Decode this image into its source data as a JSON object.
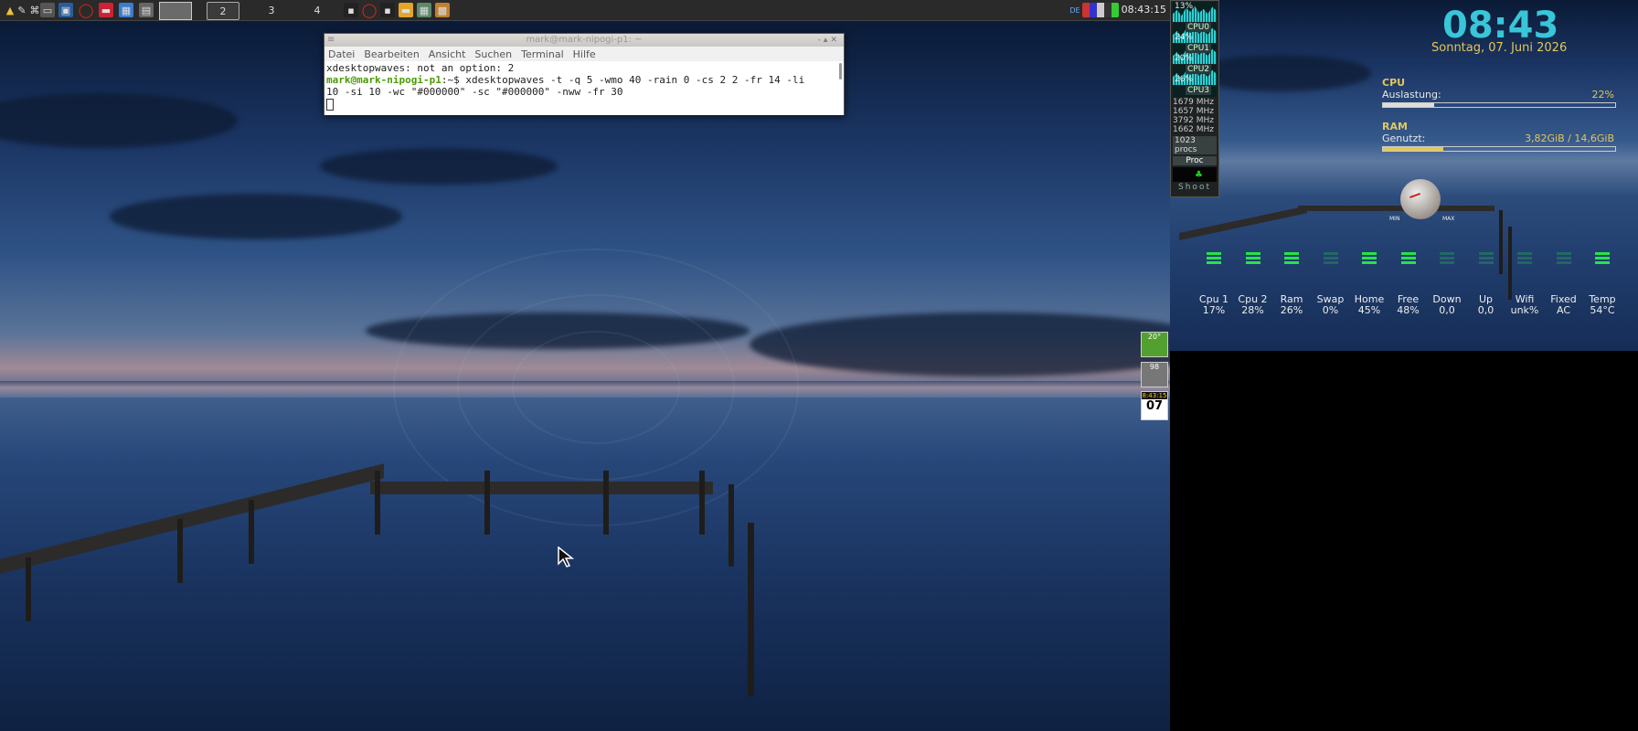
{
  "taskbar": {
    "workspaces": [
      {
        "label": ""
      },
      {
        "label": "2"
      },
      {
        "label": "3"
      },
      {
        "label": "4"
      }
    ],
    "clock": "08:43:15",
    "tray_label": "DE"
  },
  "terminal": {
    "title": "mark@mark-nipogi-p1: ~",
    "menu": [
      "Datei",
      "Bearbeiten",
      "Ansicht",
      "Suchen",
      "Terminal",
      "Hilfe"
    ],
    "line1": "xdesktopwaves: not an option: 2",
    "prompt": "mark@mark-nipogi-p1",
    "prompt_suffix": ":~$ ",
    "command": "xdesktopwaves -t -q 5 -wmo 40 -rain 0 -cs 2 2 -fr 14 -li",
    "line3": "10 -si 10 -wc \"#000000\" -sc \"#000000\" -nww -fr 30"
  },
  "gkrellm": {
    "cpu_total": "13%",
    "cpus": [
      {
        "name": "CPU0",
        "value": "24%"
      },
      {
        "name": "CPU1",
        "value": "20%"
      },
      {
        "name": "CPU2",
        "value": "26%"
      },
      {
        "name": "CPU3",
        "value": ""
      }
    ],
    "freqs": [
      "1679 MHz",
      "1657 MHz",
      "3792 MHz",
      "1662 MHz"
    ],
    "procs": "1023 procs",
    "proc_label": "Proc",
    "shoot": "Shoot"
  },
  "conky": {
    "time": "08:43",
    "date": "Sonntag, 07. Juni 2026",
    "cpu_heading": "CPU",
    "cpu_label": "Auslastung:",
    "cpu_value": "22%",
    "cpu_fraction": 0.22,
    "ram_heading": "RAM",
    "ram_label": "Genutzt:",
    "ram_value": "3,82GiB / 14,6GiB",
    "ram_fraction": 0.26,
    "dial_min": "MIN",
    "dial_max": "MAX",
    "meters": [
      {
        "name": "Cpu 1",
        "value": "17%",
        "lit": true
      },
      {
        "name": "Cpu 2",
        "value": "28%",
        "lit": true
      },
      {
        "name": "Ram",
        "value": "26%",
        "lit": true
      },
      {
        "name": "Swap",
        "value": "0%",
        "lit": false
      },
      {
        "name": "Home",
        "value": "45%",
        "lit": true
      },
      {
        "name": "Free",
        "value": "48%",
        "lit": true
      },
      {
        "name": "Down",
        "value": "0,0",
        "lit": false
      },
      {
        "name": "Up",
        "value": "0,0",
        "lit": false
      },
      {
        "name": "Wifi",
        "value": "unk%",
        "lit": false
      },
      {
        "name": "Fixed",
        "value": "AC",
        "lit": false
      },
      {
        "name": "Temp",
        "value": "54°C",
        "lit": true
      }
    ]
  },
  "dock": {
    "temp": "20°",
    "mem": "98",
    "date_time": "8:43:15",
    "date_day": "07"
  },
  "colors": {
    "accent_cyan": "#38c6d8",
    "accent_yellow": "#e2c75c",
    "meter_green": "#28e24a"
  }
}
